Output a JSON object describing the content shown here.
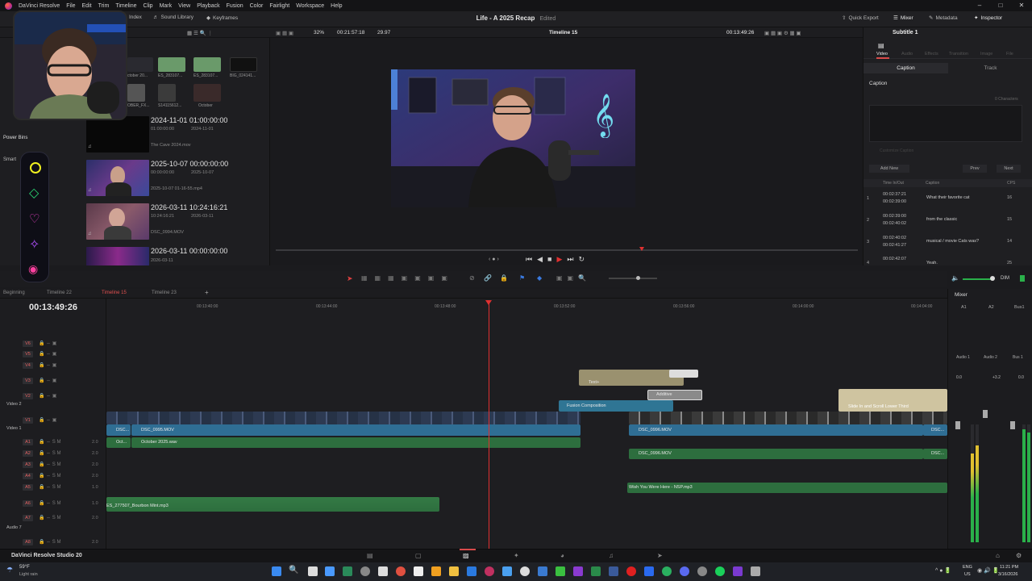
{
  "menu": {
    "app": "DaVinci Resolve",
    "items": [
      "File",
      "Edit",
      "Trim",
      "Timeline",
      "Clip",
      "Mark",
      "View",
      "Playback",
      "Fusion",
      "Color",
      "Fairlight",
      "Workspace",
      "Help"
    ]
  },
  "toolbar": {
    "index": "Index",
    "sound_library": "Sound Library",
    "keyframes": "Keyframes",
    "project_title": "Life - A 2025 Recap",
    "edited": "Edited",
    "quick_export": "Quick Export",
    "mixer": "Mixer",
    "metadata": "Metadata",
    "inspector": "Inspector"
  },
  "viewbar": {
    "zoom": "32%",
    "source_tc": "00:21:57:18",
    "fps": "29.97",
    "timeline_name": "Timeline 15",
    "record_tc": "00:13:49:26",
    "subtitle": "Subtitle 1"
  },
  "mediapool": {
    "top_thumbs": [
      "ctober 20...",
      "ES_283107...",
      "ES_283107...",
      "BIG_024141...",
      "OBER_FX...",
      "S14115612...",
      "October"
    ],
    "power_bins": "Power Bins",
    "smart": "Smart",
    "clips": [
      {
        "title": "2024-11-01 01:00:00:00",
        "start": "01:00:00:00",
        "date": "2024-11-01",
        "file": "The Cave 2024.mov"
      },
      {
        "title": "2025-10-07 00:00:00:00",
        "start": "00:00:00:00",
        "date": "2025-10-07",
        "file": "2025-10-07 01-16-55.mp4"
      },
      {
        "title": "2026-03-11 10:24:16:21",
        "start": "10:24:16:21",
        "date": "2026-03-11",
        "file": "DSC_0994.MOV"
      },
      {
        "title": "2026-03-11 00:00:00:00",
        "start": "",
        "date": "",
        "file": "2026-03-11"
      }
    ]
  },
  "inspector": {
    "tabs": [
      "Video",
      "Audio",
      "Effects",
      "Transition",
      "Image",
      "File"
    ],
    "caption_tab": "Caption",
    "track_tab": "Track",
    "caption_label": "Caption",
    "characters": "0 Characters",
    "customize": "Customize Caption",
    "add_new": "Add New",
    "prev": "Prev",
    "next": "Next",
    "col_time": "Time In/Out",
    "col_caption": "Caption",
    "col_cps": "CPS",
    "rows": [
      {
        "n": "1",
        "tin": "00:02:37:21",
        "tout": "00:02:39:00",
        "text": "What their favorite cat",
        "cps": "16"
      },
      {
        "n": "2",
        "tin": "00:02:39:00",
        "tout": "00:02:40:02",
        "text": "from the classic",
        "cps": "15"
      },
      {
        "n": "3",
        "tin": "00:02:40:02",
        "tout": "00:02:41:27",
        "text": "musical / movie Cats was?",
        "cps": "14"
      },
      {
        "n": "4",
        "tin": "00:02:42:07",
        "tout": "",
        "text": "Yeah.",
        "cps": "25"
      }
    ]
  },
  "timeline": {
    "tabs": [
      "Beginning",
      "Timeline 22",
      "Timeline 15",
      "Timeline 23"
    ],
    "timecode": "00:13:49:26",
    "ruler": [
      "00:13:40:00",
      "00:13:44:00",
      "00:13:48:00",
      "00:13:52:00",
      "00:13:56:00",
      "00:14:00:00",
      "00:14:04:00"
    ],
    "video_tracks": [
      {
        "id": "V6"
      },
      {
        "id": "V5"
      },
      {
        "id": "V4"
      },
      {
        "id": "V3"
      },
      {
        "id": "V2",
        "label": "Video 2"
      },
      {
        "id": "V1",
        "label": "Video 1"
      }
    ],
    "audio_tracks": [
      {
        "id": "A1",
        "vol": "2.0"
      },
      {
        "id": "A2",
        "vol": "2.0"
      },
      {
        "id": "A3",
        "vol": "2.0"
      },
      {
        "id": "A4",
        "vol": "2.0"
      },
      {
        "id": "A5",
        "vol": "1.0"
      },
      {
        "id": "A6",
        "vol": "1.0"
      },
      {
        "id": "A7",
        "vol": "2.0",
        "label": "Audio 7"
      },
      {
        "id": "A8",
        "vol": "2.0"
      }
    ],
    "clips": {
      "text": "Text+",
      "additive": "Additive",
      "fusion": "Fusion Composition",
      "slide": "Slide In and Scroll Lower Third",
      "v1a_short": "DSC...",
      "v1a": "DSC_0995.MOV",
      "v1b": "DSC_0996.MOV",
      "v1c": "DSC...",
      "a1_short": "Oct...",
      "a1": "October 2025.wav",
      "a2": "DSC_0996.MOV",
      "a2c": "DSC...",
      "a5": "Wish You Were Here - NSP.mp3",
      "a6": "ES_277507_Bourbon Mint.mp3"
    }
  },
  "mixer": {
    "title": "Mixer",
    "channels": [
      "A1",
      "A2",
      "Bus1"
    ],
    "names": [
      "Audio 1",
      "Audio 2",
      "Bus 1"
    ],
    "vals": [
      "0.0",
      "+3.2",
      "0.0"
    ],
    "dim": "DIM"
  },
  "pagebar": {
    "app_name": "DaVinci Resolve Studio 20"
  },
  "taskbar": {
    "temp": "59°F",
    "weather": "Light rain",
    "lang": "ENG",
    "region": "US",
    "time": "11:21 PM",
    "date": "3/16/2026"
  },
  "colors": {
    "accent": "#d94a4a",
    "video_clip": "#2f6e94",
    "audio_clip": "#2d6e3e",
    "playhead": "#e03030"
  }
}
